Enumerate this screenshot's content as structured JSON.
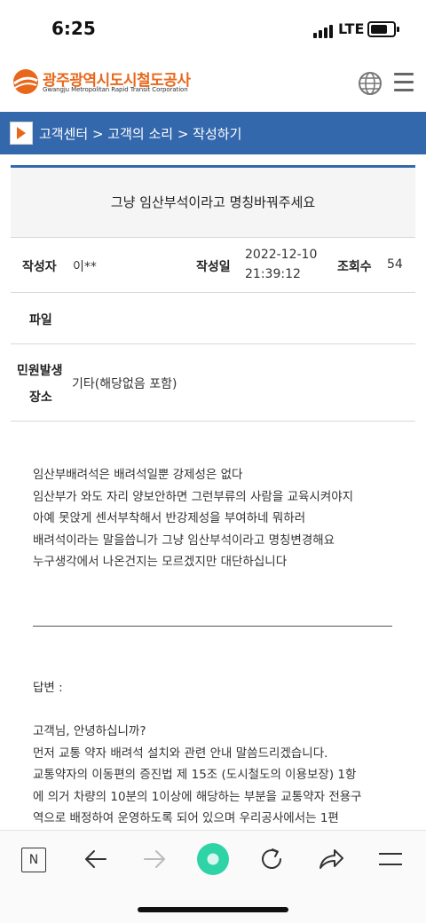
{
  "status": {
    "time": "6:25",
    "network": "LTE"
  },
  "header": {
    "logo_ko": "광주광역시도시철도공사",
    "logo_en": "Gwangju Metropolitan Rapid Transit Corporation",
    "brand_color": "#e8671b",
    "icons": [
      "globe-icon",
      "hamburger-menu-icon"
    ]
  },
  "breadcrumb": {
    "text": "고객센터 > 고객의 소리 > 작성하기",
    "bar_color": "#3468ad"
  },
  "post": {
    "title": "그냥 임산부석이라고 명칭바꿔주세요",
    "author_label": "작성자",
    "author": "이**",
    "date_label": "작성일",
    "date": "2022-12-10",
    "time": "21:39:12",
    "views_label": "조회수",
    "views": "54",
    "file_label": "파일",
    "place_label_1": "민원발생",
    "place_label_2": "장소",
    "place": "기타(해당없음 포함)",
    "body": [
      "임산부배려석은 배려석일뿐 강제성은 없다",
      "임산부가 와도 자리 양보안하면 그런부류의 사람을 교육시켜야지",
      "아예 못앉게 센서부착해서 반강제성을 부여하네 뭐하러",
      "배려석이라는 말을씁니가 그냥 임산부석이라고 명칭변경해요",
      "누구생각에서 나온건지는 모르겠지만 대단하십니다"
    ]
  },
  "answer": {
    "label": "답변 :",
    "lines": [
      "고객님, 안녕하십니까?",
      "먼저 교통 약자 배려석 설치와 관련 안내 말씀드리겠습니다.",
      "교통약자의 이동편의 증진법 제 15조 (도시철도의 이용보장) 1항",
      "에 의거 차량의 10분의 1이상에 해당하는 부분을 교통약자 전용구",
      "역으로 배정하여 운영하도록 되어 있으며 우리공사에서는 1편"
    ]
  },
  "browser_bar": {
    "n_label": "N",
    "icons": [
      "back-arrow-icon",
      "forward-arrow-icon",
      "home-circle-icon",
      "refresh-icon",
      "share-icon",
      "menu-icon"
    ]
  }
}
